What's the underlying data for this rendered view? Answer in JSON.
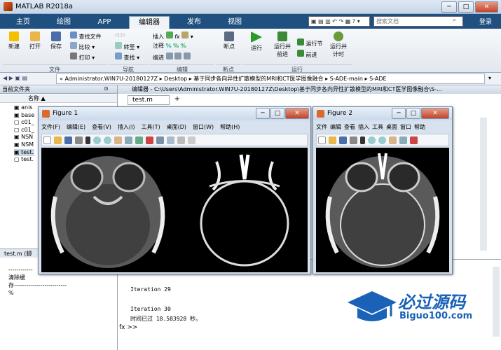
{
  "app": {
    "title": "MATLAB R2018a",
    "minimize": "─",
    "maximize": "□",
    "close": "✕"
  },
  "tabs": [
    "主页",
    "绘图",
    "APP",
    "编辑器",
    "发布",
    "视图"
  ],
  "search": {
    "placeholder": "搜索文档",
    "login": "登录"
  },
  "ribbon": {
    "new": "新建",
    "open": "打开",
    "save": "保存",
    "find_files": "查找文件",
    "compare": "比较",
    "print": "打印",
    "goto": "转至",
    "find": "查找",
    "insert": "插入",
    "comment": "注释",
    "indent": "缩进",
    "fx": "fx",
    "breakpoint": "断点",
    "run": "运行",
    "run_advance": "运行并\n前进",
    "run_section": "运行节",
    "advance": "前进",
    "run_time": "运行并\n计时",
    "groups": [
      "文件",
      "导航",
      "编辑",
      "断点",
      "运行"
    ]
  },
  "address": {
    "path": "« Administrator.WIN7U-20180127Z ▸ Desktop ▸ 基于同步各向异性扩散模型的MRI和CT医学图像融合 ▸ S-ADE-main ▸ S-ADE"
  },
  "current_folder": {
    "title": "当前文件夹",
    "col": "名称 ▲",
    "files": [
      "anis",
      "base",
      "c01_",
      "c01_",
      "NSN",
      "NSM",
      "test.",
      "test."
    ]
  },
  "details": {
    "label": "test.m (脚",
    "dash": "------------",
    "clear": "清除缓",
    "cache": "存--------------------------",
    "percent": "%"
  },
  "editor": {
    "header": "编辑器 - C:\\Users\\Administrator.WIN7U-20180127Z\\Desktop\\基于同步各向异性扩散模型的MRI和CT医学图像融合\\S-...",
    "tab": "test.m",
    "add": "+"
  },
  "console": {
    "line1": "Iteration 29",
    "line2": "Iteration 30",
    "line3": "时间已过 18.583928 秒。",
    "prompt": "fx >>"
  },
  "fig1": {
    "title": "Figure 1",
    "menus": [
      "文件(F)",
      "编辑(E)",
      "查看(V)",
      "插入(I)",
      "工具(T)",
      "桌面(D)",
      "窗口(W)",
      "帮助(H)"
    ]
  },
  "fig2": {
    "title": "Figure 2",
    "menus": [
      "文件",
      "编辑",
      "查看",
      "插入",
      "工具",
      "桌面",
      "窗口",
      "帮助"
    ]
  },
  "watermark": {
    "cn": "必过源码",
    "en": "Biguo100.com"
  }
}
